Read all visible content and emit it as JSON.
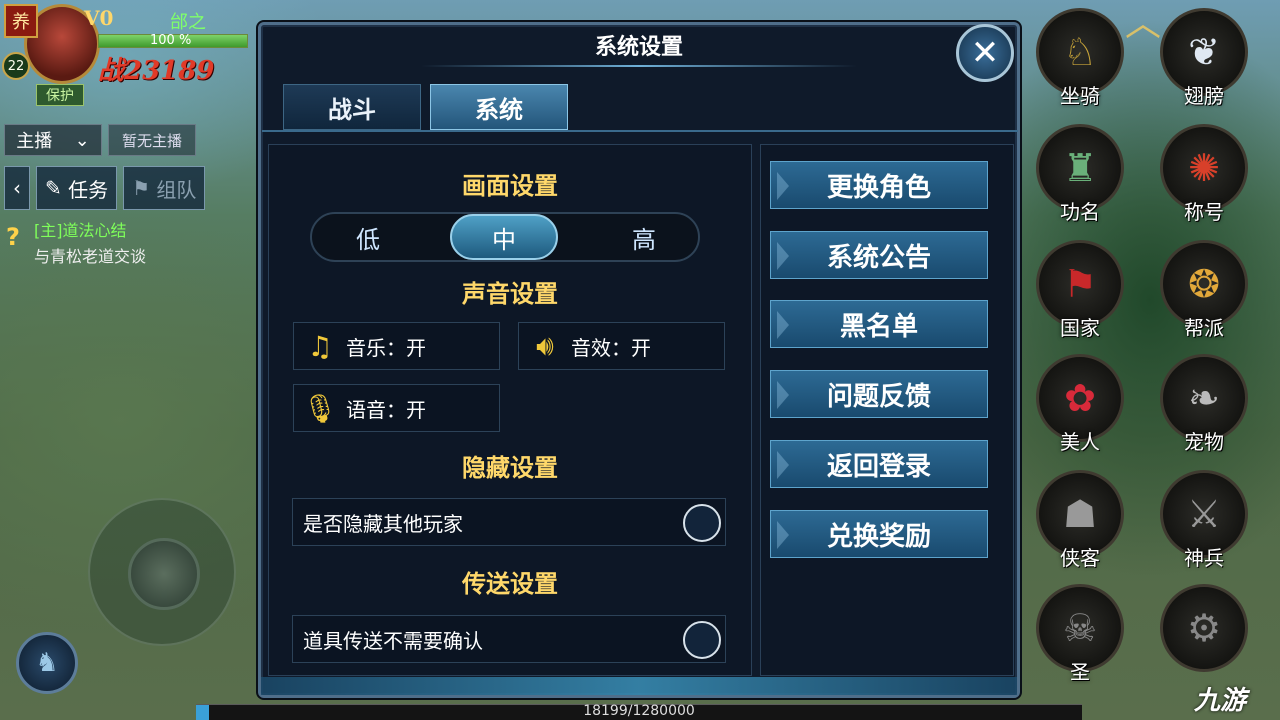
{
  "hud": {
    "badge": "养",
    "vip": "V0",
    "name": "邰之",
    "level": "22",
    "hp_percent": "100 %",
    "hp_fill": 1.0,
    "power": "战23189",
    "protect": "保护",
    "stream_label": "主播",
    "no_stream": "暂无主播",
    "task_label": "任务",
    "team_label": "组队",
    "quest_main": "[主]道法心结",
    "quest_sub": "与青松老道交谈"
  },
  "dialog": {
    "title": "系统设置",
    "tabs": [
      {
        "label": "战斗",
        "active": false
      },
      {
        "label": "系统",
        "active": true
      }
    ],
    "graphics": {
      "title": "画面设置",
      "options": [
        "低",
        "中",
        "高"
      ],
      "selected": "中"
    },
    "sound": {
      "title": "声音设置",
      "music": "音乐：开",
      "effects": "音效：开",
      "voice": "语音：开"
    },
    "hide": {
      "title": "隐藏设置",
      "hide_players": "是否隐藏其他玩家"
    },
    "teleport": {
      "title": "传送设置",
      "no_confirm": "道具传送不需要确认"
    },
    "menu": [
      "更换角色",
      "系统公告",
      "黑名单",
      "问题反馈",
      "返回登录",
      "兑换奖励"
    ]
  },
  "right_icons": [
    "坐骑",
    "翅膀",
    "功名",
    "称号",
    "国家",
    "帮派",
    "美人",
    "宠物",
    "侠客",
    "神兵",
    "圣"
  ],
  "exp": {
    "text": "18199/1280000",
    "fraction": 0.0142
  },
  "watermark": "九游"
}
